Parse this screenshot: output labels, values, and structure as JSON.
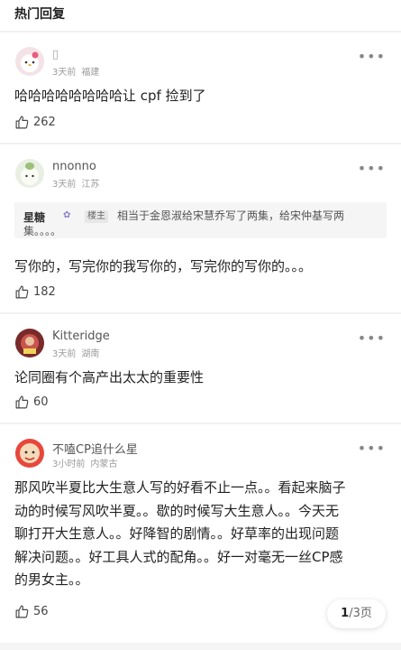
{
  "section": {
    "title": "热门回复"
  },
  "comments": [
    {
      "name": "▯",
      "time": "3天前",
      "location": "福建",
      "text": "哈哈哈哈哈哈哈哈让 cpf 捡到了",
      "likes": "262"
    },
    {
      "name": "nnonno",
      "time": "3天前",
      "location": "江苏",
      "reply": {
        "author": "星糖",
        "badge": "楼主",
        "text": "相当于金恩淑给宋慧乔写了两集，给宋仲基写两",
        "text2": "集。。。。"
      },
      "text": "写你的，写完你的我写你的，写完你的写你的。。。",
      "likes": "182"
    },
    {
      "name": "Kitteridge",
      "time": "3天前",
      "location": "湖南",
      "text": "论同圈有个高产出太太的重要性",
      "likes": "60"
    },
    {
      "name": "不嗑CP追什么星",
      "time": "3小时前",
      "location": "内蒙古",
      "text_lines": [
        "那风吹半夏比大生意人写的好看不止一点。。看起来脑子",
        "动的时候写风吹半夏。。歇的时候写大生意人。。今天无",
        "聊打开大生意人。。好降智的剧情。。好草率的出现问题",
        "解决问题。。好工具人式的配角。。好一对毫无一丝CP感",
        "的男女主。。"
      ],
      "likes": "56"
    }
  ],
  "pager": {
    "current": "1",
    "total": "/3页"
  },
  "icons": {
    "more": "more-icon",
    "like": "thumbs-up-icon"
  }
}
